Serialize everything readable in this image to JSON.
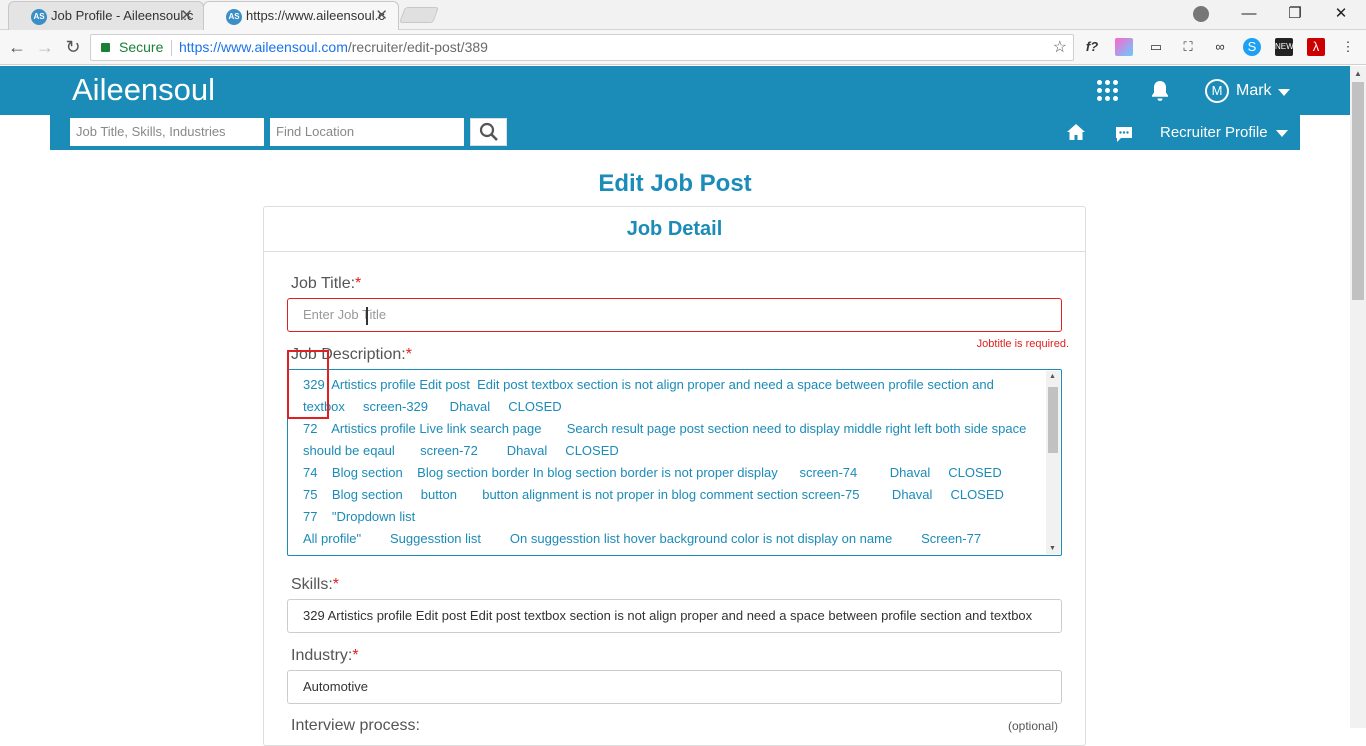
{
  "browser": {
    "tabs": [
      {
        "title": "Job Profile - Aileensoul.c",
        "favicon": "AS"
      },
      {
        "title": "https://www.aileensoul.c",
        "favicon": "AS"
      }
    ],
    "secure_label": "Secure",
    "url_host": "https://www.aileensoul.com",
    "url_path": "/recruiter/edit-post/389"
  },
  "site": {
    "logo": "Aileensoul",
    "user_initial": "M",
    "user_name": "Mark",
    "search_title_placeholder": "Job Title, Skills, Industries",
    "search_location_placeholder": "Find Location",
    "recruiter_menu": "Recruiter Profile"
  },
  "form": {
    "page_title": "Edit Job Post",
    "card_title": "Job Detail",
    "job_title_label": "Job Title:",
    "job_title_placeholder": "Enter Job Title",
    "job_title_error": "Jobtitle is required.",
    "job_description_label": "Job Description:",
    "job_description_lines": [
      "329  Artistics profile Edit post  Edit post textbox section is not align proper and need a space between profile section and",
      "textbox     screen-329      Dhaval     CLOSED",
      "72    Artistics profile Live link search page       Search result page post section need to display middle right left both side space",
      "should be eqaul       screen-72        Dhaval     CLOSED",
      "74    Blog section    Blog section border In blog section border is not proper display      screen-74         Dhaval     CLOSED",
      "75    Blog section     button       button alignment is not proper in blog comment section screen-75         Dhaval     CLOSED",
      "77    \"Dropdown list",
      "All profile\"        Suggesstion list        On suggesstion list hover background color is not display on name        Screen-77"
    ],
    "skills_label": "Skills:",
    "skills_value": "329  Artistics profile Edit post  Edit post textbox section is not align proper and need a space between profile section and textbox",
    "industry_label": "Industry:",
    "industry_value": "Automotive",
    "interview_label": "Interview process:",
    "interview_optional": "(optional)"
  },
  "colors": {
    "brand": "#1b8bb7",
    "error": "#e02020"
  }
}
